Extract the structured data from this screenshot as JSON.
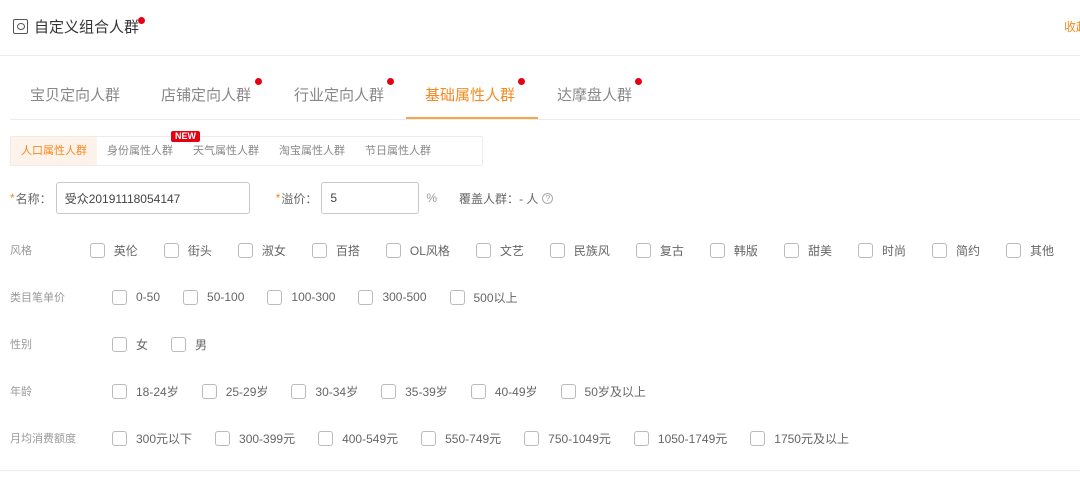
{
  "header": {
    "title": "自定义组合人群",
    "collapse": "收起"
  },
  "tabs": [
    {
      "label": "宝贝定向人群",
      "dot": false
    },
    {
      "label": "店铺定向人群",
      "dot": true
    },
    {
      "label": "行业定向人群",
      "dot": true
    },
    {
      "label": "基础属性人群",
      "dot": true,
      "active": true
    },
    {
      "label": "达摩盘人群",
      "dot": true
    }
  ],
  "subtabs": [
    {
      "label": "人口属性人群",
      "active": true
    },
    {
      "label": "身份属性人群",
      "badge": "NEW"
    },
    {
      "label": "天气属性人群"
    },
    {
      "label": "淘宝属性人群"
    },
    {
      "label": "节日属性人群"
    }
  ],
  "form": {
    "name_label": "名称：",
    "name_value": "受众20191118054147",
    "premium_label": "溢价：",
    "premium_value": "5",
    "percent": "%",
    "coverage_label": "覆盖人群：",
    "coverage_value": "- 人",
    "help": "?",
    "required": "*"
  },
  "rows": [
    {
      "label": "风格",
      "options": [
        "英伦",
        "街头",
        "淑女",
        "百搭",
        "OL风格",
        "文艺",
        "民族风",
        "复古",
        "韩版",
        "甜美",
        "时尚",
        "简约",
        "其他"
      ]
    },
    {
      "label": "类目笔单价",
      "options": [
        "0-50",
        "50-100",
        "100-300",
        "300-500",
        "500以上"
      ]
    },
    {
      "label": "性别",
      "options": [
        "女",
        "男"
      ]
    },
    {
      "label": "年龄",
      "options": [
        "18-24岁",
        "25-29岁",
        "30-34岁",
        "35-39岁",
        "40-49岁",
        "50岁及以上"
      ]
    },
    {
      "label": "月均消费额度",
      "options": [
        "300元以下",
        "300-399元",
        "400-549元",
        "550-749元",
        "750-1049元",
        "1050-1749元",
        "1750元及以上"
      ]
    }
  ],
  "colors": {
    "accent": "#f5891f",
    "dot": "#e60012"
  }
}
